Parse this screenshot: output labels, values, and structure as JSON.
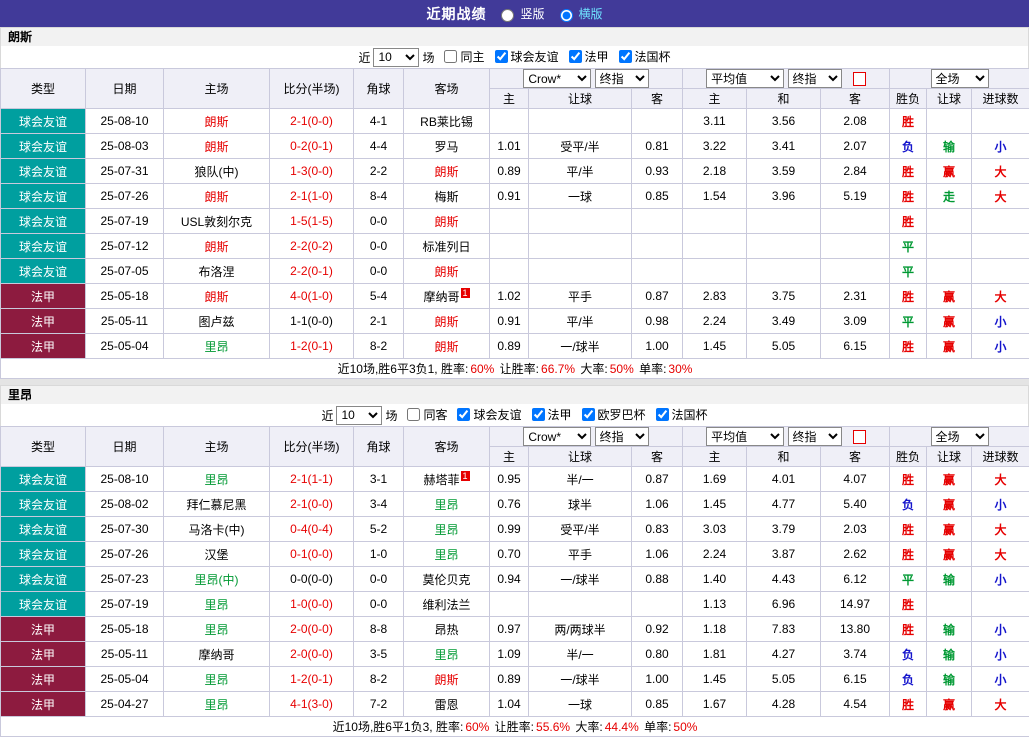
{
  "topbar": {
    "title": "近期战绩",
    "options": [
      {
        "label": "竖版",
        "selected": false
      },
      {
        "label": "横版",
        "selected": true
      }
    ]
  },
  "colors": {
    "topbar_bg": "#413a99",
    "friendly_bg": "#009f9f",
    "ligue1_bg": "#8d1b3f",
    "win_red": "#e60000",
    "lose_blue": "#1414cc",
    "draw_green": "#009933",
    "home_team_red": "#e60000",
    "away_team_green": "#008800"
  },
  "type_styles": {
    "球会友谊": "friendly",
    "法甲": "ligue1"
  },
  "table_header": {
    "odds_source": "Crow*",
    "odds_kind": "终指",
    "avg_source": "平均值",
    "avg_kind": "终指",
    "scope": "全场",
    "cols": [
      "类型",
      "日期",
      "主场",
      "比分(半场)",
      "角球",
      "客场",
      "主",
      "让球",
      "客",
      "主",
      "和",
      "客",
      "胜负",
      "让球",
      "进球数"
    ]
  },
  "sections": [
    {
      "team": "朗斯",
      "filter": {
        "prefix": "近",
        "count": "10",
        "suffix": "场",
        "checkboxes": [
          {
            "label": "同主",
            "checked": false
          },
          {
            "label": "球会友谊",
            "checked": true
          },
          {
            "label": "法甲",
            "checked": true
          },
          {
            "label": "法国杯",
            "checked": true
          }
        ]
      },
      "rows": [
        {
          "type": "球会友谊",
          "date": "25-08-10",
          "home": "朗斯",
          "home_color": "red",
          "score": "2-1(0-0)",
          "score_color": "red",
          "corner": "4-1",
          "away": "RB莱比锡",
          "away_color": "black",
          "odds": [
            "",
            "",
            ""
          ],
          "avg": [
            "3.11",
            "3.56",
            "2.08"
          ],
          "result": "胜",
          "result_color": "red",
          "handicap": "",
          "handicap_color": "black",
          "goals": "",
          "goals_color": "black"
        },
        {
          "type": "球会友谊",
          "date": "25-08-03",
          "home": "朗斯",
          "home_color": "red",
          "score": "0-2(0-1)",
          "score_color": "red",
          "corner": "4-4",
          "away": "罗马",
          "away_color": "black",
          "odds": [
            "1.01",
            "受平/半",
            "0.81"
          ],
          "avg": [
            "3.22",
            "3.41",
            "2.07"
          ],
          "result": "负",
          "result_color": "blue",
          "handicap": "输",
          "handicap_color": "green",
          "goals": "小",
          "goals_color": "blue"
        },
        {
          "type": "球会友谊",
          "date": "25-07-31",
          "home": "狼队(中)",
          "home_color": "black",
          "score": "1-3(0-0)",
          "score_color": "red",
          "corner": "2-2",
          "away": "朗斯",
          "away_color": "red",
          "odds": [
            "0.89",
            "平/半",
            "0.93"
          ],
          "avg": [
            "2.18",
            "3.59",
            "2.84"
          ],
          "result": "胜",
          "result_color": "red",
          "handicap": "赢",
          "handicap_color": "red",
          "goals": "大",
          "goals_color": "red"
        },
        {
          "type": "球会友谊",
          "date": "25-07-26",
          "home": "朗斯",
          "home_color": "red",
          "score": "2-1(1-0)",
          "score_color": "red",
          "corner": "8-4",
          "away": "梅斯",
          "away_color": "black",
          "odds": [
            "0.91",
            "一球",
            "0.85"
          ],
          "avg": [
            "1.54",
            "3.96",
            "5.19"
          ],
          "result": "胜",
          "result_color": "red",
          "handicap": "走",
          "handicap_color": "green",
          "goals": "大",
          "goals_color": "red"
        },
        {
          "type": "球会友谊",
          "date": "25-07-19",
          "home": "USL敦刻尔克",
          "home_color": "black",
          "score": "1-5(1-5)",
          "score_color": "red",
          "corner": "0-0",
          "away": "朗斯",
          "away_color": "red",
          "odds": [
            "",
            "",
            ""
          ],
          "avg": [
            "",
            "",
            ""
          ],
          "result": "胜",
          "result_color": "red",
          "handicap": "",
          "handicap_color": "black",
          "goals": "",
          "goals_color": "black"
        },
        {
          "type": "球会友谊",
          "date": "25-07-12",
          "home": "朗斯",
          "home_color": "red",
          "score": "2-2(0-2)",
          "score_color": "red",
          "corner": "0-0",
          "away": "标准列日",
          "away_color": "black",
          "odds": [
            "",
            "",
            ""
          ],
          "avg": [
            "",
            "",
            ""
          ],
          "result": "平",
          "result_color": "green",
          "handicap": "",
          "handicap_color": "black",
          "goals": "",
          "goals_color": "black"
        },
        {
          "type": "球会友谊",
          "date": "25-07-05",
          "home": "布洛涅",
          "home_color": "black",
          "score": "2-2(0-1)",
          "score_color": "red",
          "corner": "0-0",
          "away": "朗斯",
          "away_color": "red",
          "odds": [
            "",
            "",
            ""
          ],
          "avg": [
            "",
            "",
            ""
          ],
          "result": "平",
          "result_color": "green",
          "handicap": "",
          "handicap_color": "black",
          "goals": "",
          "goals_color": "black"
        },
        {
          "type": "法甲",
          "date": "25-05-18",
          "home": "朗斯",
          "home_color": "red",
          "score": "4-0(1-0)",
          "score_color": "red",
          "corner": "5-4",
          "away": "摩纳哥",
          "away_color": "black",
          "away_badge": "1",
          "odds": [
            "1.02",
            "平手",
            "0.87"
          ],
          "avg": [
            "2.83",
            "3.75",
            "2.31"
          ],
          "result": "胜",
          "result_color": "red",
          "handicap": "赢",
          "handicap_color": "red",
          "goals": "大",
          "goals_color": "red"
        },
        {
          "type": "法甲",
          "date": "25-05-11",
          "home": "图卢兹",
          "home_color": "black",
          "score": "1-1(0-0)",
          "score_color": "black",
          "corner": "2-1",
          "away": "朗斯",
          "away_color": "red",
          "odds": [
            "0.91",
            "平/半",
            "0.98"
          ],
          "avg": [
            "2.24",
            "3.49",
            "3.09"
          ],
          "result": "平",
          "result_color": "green",
          "handicap": "赢",
          "handicap_color": "red",
          "goals": "小",
          "goals_color": "blue"
        },
        {
          "type": "法甲",
          "date": "25-05-04",
          "home": "里昂",
          "home_color": "green",
          "score": "1-2(0-1)",
          "score_color": "red",
          "corner": "8-2",
          "away": "朗斯",
          "away_color": "red",
          "odds": [
            "0.89",
            "一/球半",
            "1.00"
          ],
          "avg": [
            "1.45",
            "5.05",
            "6.15"
          ],
          "result": "胜",
          "result_color": "red",
          "handicap": "赢",
          "handicap_color": "red",
          "goals": "小",
          "goals_color": "blue"
        }
      ],
      "summary": [
        {
          "text": "近10场,胜6平3负1, 胜率:",
          "color": "black"
        },
        {
          "text": "60%",
          "color": "red"
        },
        {
          "text": " 让胜率:",
          "color": "black"
        },
        {
          "text": "66.7%",
          "color": "red"
        },
        {
          "text": " 大率:",
          "color": "black"
        },
        {
          "text": "50%",
          "color": "red"
        },
        {
          "text": " 单率:",
          "color": "black"
        },
        {
          "text": "30%",
          "color": "red"
        }
      ]
    },
    {
      "team": "里昂",
      "filter": {
        "prefix": "近",
        "count": "10",
        "suffix": "场",
        "checkboxes": [
          {
            "label": "同客",
            "checked": false
          },
          {
            "label": "球会友谊",
            "checked": true
          },
          {
            "label": "法甲",
            "checked": true
          },
          {
            "label": "欧罗巴杯",
            "checked": true
          },
          {
            "label": "法国杯",
            "checked": true
          }
        ]
      },
      "rows": [
        {
          "type": "球会友谊",
          "date": "25-08-10",
          "home": "里昂",
          "home_color": "green",
          "score": "2-1(1-1)",
          "score_color": "red",
          "corner": "3-1",
          "away": "赫塔菲",
          "away_color": "black",
          "away_badge": "1",
          "odds": [
            "0.95",
            "半/一",
            "0.87"
          ],
          "avg": [
            "1.69",
            "4.01",
            "4.07"
          ],
          "result": "胜",
          "result_color": "red",
          "handicap": "赢",
          "handicap_color": "red",
          "goals": "大",
          "goals_color": "red"
        },
        {
          "type": "球会友谊",
          "date": "25-08-02",
          "home": "拜仁慕尼黑",
          "home_color": "black",
          "score": "2-1(0-0)",
          "score_color": "red",
          "corner": "3-4",
          "away": "里昂",
          "away_color": "green",
          "odds": [
            "0.76",
            "球半",
            "1.06"
          ],
          "avg": [
            "1.45",
            "4.77",
            "5.40"
          ],
          "result": "负",
          "result_color": "blue",
          "handicap": "赢",
          "handicap_color": "red",
          "goals": "小",
          "goals_color": "blue"
        },
        {
          "type": "球会友谊",
          "date": "25-07-30",
          "home": "马洛卡(中)",
          "home_color": "black",
          "score": "0-4(0-4)",
          "score_color": "red",
          "corner": "5-2",
          "away": "里昂",
          "away_color": "green",
          "odds": [
            "0.99",
            "受平/半",
            "0.83"
          ],
          "avg": [
            "3.03",
            "3.79",
            "2.03"
          ],
          "result": "胜",
          "result_color": "red",
          "handicap": "赢",
          "handicap_color": "red",
          "goals": "大",
          "goals_color": "red"
        },
        {
          "type": "球会友谊",
          "date": "25-07-26",
          "home": "汉堡",
          "home_color": "black",
          "score": "0-1(0-0)",
          "score_color": "red",
          "corner": "1-0",
          "away": "里昂",
          "away_color": "green",
          "odds": [
            "0.70",
            "平手",
            "1.06"
          ],
          "avg": [
            "2.24",
            "3.87",
            "2.62"
          ],
          "result": "胜",
          "result_color": "red",
          "handicap": "赢",
          "handicap_color": "red",
          "goals": "大",
          "goals_color": "red"
        },
        {
          "type": "球会友谊",
          "date": "25-07-23",
          "home": "里昂(中)",
          "home_color": "green",
          "score": "0-0(0-0)",
          "score_color": "black",
          "corner": "0-0",
          "away": "莫伦贝克",
          "away_color": "black",
          "odds": [
            "0.94",
            "一/球半",
            "0.88"
          ],
          "avg": [
            "1.40",
            "4.43",
            "6.12"
          ],
          "result": "平",
          "result_color": "green",
          "handicap": "输",
          "handicap_color": "green",
          "goals": "小",
          "goals_color": "blue"
        },
        {
          "type": "球会友谊",
          "date": "25-07-19",
          "home": "里昂",
          "home_color": "green",
          "score": "1-0(0-0)",
          "score_color": "red",
          "corner": "0-0",
          "away": "维利法兰",
          "away_color": "black",
          "odds": [
            "",
            "",
            ""
          ],
          "avg": [
            "1.13",
            "6.96",
            "14.97"
          ],
          "result": "胜",
          "result_color": "red",
          "handicap": "",
          "handicap_color": "black",
          "goals": "",
          "goals_color": "black"
        },
        {
          "type": "法甲",
          "date": "25-05-18",
          "home": "里昂",
          "home_color": "green",
          "score": "2-0(0-0)",
          "score_color": "red",
          "corner": "8-8",
          "away": "昂热",
          "away_color": "black",
          "odds": [
            "0.97",
            "两/两球半",
            "0.92"
          ],
          "avg": [
            "1.18",
            "7.83",
            "13.80"
          ],
          "result": "胜",
          "result_color": "red",
          "handicap": "输",
          "handicap_color": "green",
          "goals": "小",
          "goals_color": "blue"
        },
        {
          "type": "法甲",
          "date": "25-05-11",
          "home": "摩纳哥",
          "home_color": "black",
          "score": "2-0(0-0)",
          "score_color": "red",
          "corner": "3-5",
          "away": "里昂",
          "away_color": "green",
          "odds": [
            "1.09",
            "半/一",
            "0.80"
          ],
          "avg": [
            "1.81",
            "4.27",
            "3.74"
          ],
          "result": "负",
          "result_color": "blue",
          "handicap": "输",
          "handicap_color": "green",
          "goals": "小",
          "goals_color": "blue"
        },
        {
          "type": "法甲",
          "date": "25-05-04",
          "home": "里昂",
          "home_color": "green",
          "score": "1-2(0-1)",
          "score_color": "red",
          "corner": "8-2",
          "away": "朗斯",
          "away_color": "red",
          "odds": [
            "0.89",
            "一/球半",
            "1.00"
          ],
          "avg": [
            "1.45",
            "5.05",
            "6.15"
          ],
          "result": "负",
          "result_color": "blue",
          "handicap": "输",
          "handicap_color": "green",
          "goals": "小",
          "goals_color": "blue"
        },
        {
          "type": "法甲",
          "date": "25-04-27",
          "home": "里昂",
          "home_color": "green",
          "score": "4-1(3-0)",
          "score_color": "red",
          "corner": "7-2",
          "away": "雷恩",
          "away_color": "black",
          "odds": [
            "1.04",
            "一球",
            "0.85"
          ],
          "avg": [
            "1.67",
            "4.28",
            "4.54"
          ],
          "result": "胜",
          "result_color": "red",
          "handicap": "赢",
          "handicap_color": "red",
          "goals": "大",
          "goals_color": "red"
        }
      ],
      "summary": [
        {
          "text": "近10场,胜6平1负3, 胜率:",
          "color": "black"
        },
        {
          "text": "60%",
          "color": "red"
        },
        {
          "text": " 让胜率:",
          "color": "black"
        },
        {
          "text": "55.6%",
          "color": "red"
        },
        {
          "text": " 大率:",
          "color": "black"
        },
        {
          "text": "44.4%",
          "color": "red"
        },
        {
          "text": " 单率:",
          "color": "black"
        },
        {
          "text": "50%",
          "color": "red"
        }
      ]
    }
  ]
}
